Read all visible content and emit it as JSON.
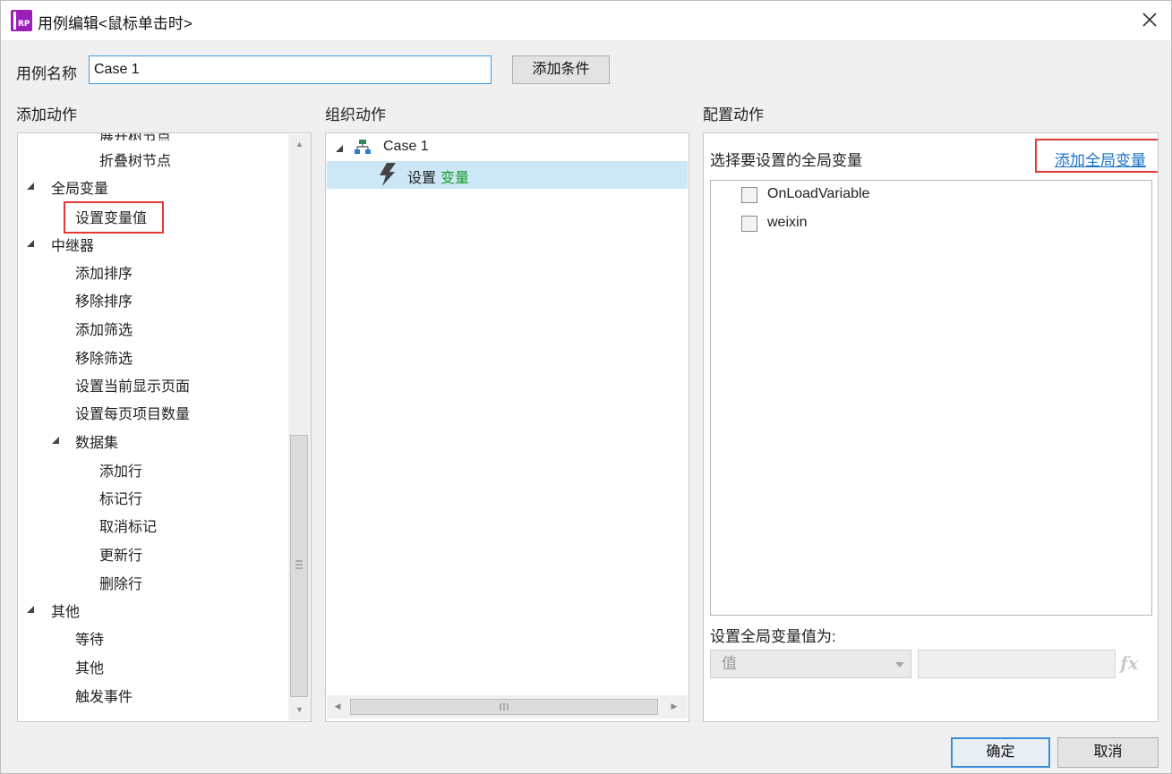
{
  "window": {
    "title": "用例编辑<鼠标单击时>",
    "app_icon_text": "RP"
  },
  "case_name": {
    "label": "用例名称",
    "value": "Case 1"
  },
  "add_condition_button": "添加条件",
  "add_action_panel": {
    "title": "添加动作",
    "items": [
      {
        "label": "展开树节点",
        "level": 3,
        "partial": true
      },
      {
        "label": "折叠树节点",
        "level": 3
      },
      {
        "label": "全局变量",
        "level": 1,
        "group": true
      },
      {
        "label": "设置变量值",
        "level": 2,
        "highlighted": true
      },
      {
        "label": "中继器",
        "level": 1,
        "group": true
      },
      {
        "label": "添加排序",
        "level": 2
      },
      {
        "label": "移除排序",
        "level": 2
      },
      {
        "label": "添加筛选",
        "level": 2
      },
      {
        "label": "移除筛选",
        "level": 2
      },
      {
        "label": "设置当前显示页面",
        "level": 2
      },
      {
        "label": "设置每页项目数量",
        "level": 2
      },
      {
        "label": "数据集",
        "level": 2,
        "group": true
      },
      {
        "label": "添加行",
        "level": 3
      },
      {
        "label": "标记行",
        "level": 3
      },
      {
        "label": "取消标记",
        "level": 3
      },
      {
        "label": "更新行",
        "level": 3
      },
      {
        "label": "删除行",
        "level": 3
      },
      {
        "label": "其他",
        "level": 1,
        "group": true
      },
      {
        "label": "等待",
        "level": 2
      },
      {
        "label": "其他",
        "level": 2
      },
      {
        "label": "触发事件",
        "level": 2
      }
    ]
  },
  "organize_panel": {
    "title": "组织动作",
    "case_label": "Case 1",
    "action_prefix": "设置",
    "action_target": "变量"
  },
  "configure_panel": {
    "title": "配置动作",
    "select_prompt": "选择要设置的全局变量",
    "add_variable_link": "添加全局变量",
    "variables": [
      "OnLoadVariable",
      "weixin"
    ],
    "set_value_label": "设置全局变量值为:",
    "value_type_selected": "值",
    "fx_label": "fx"
  },
  "footer": {
    "ok_label": "确定",
    "cancel_label": "取消"
  },
  "colors": {
    "accent": "#3c9be0",
    "highlight_box": "#e53935",
    "selected_row": "#cce8f7",
    "variable_text": "#1a9d2a"
  }
}
